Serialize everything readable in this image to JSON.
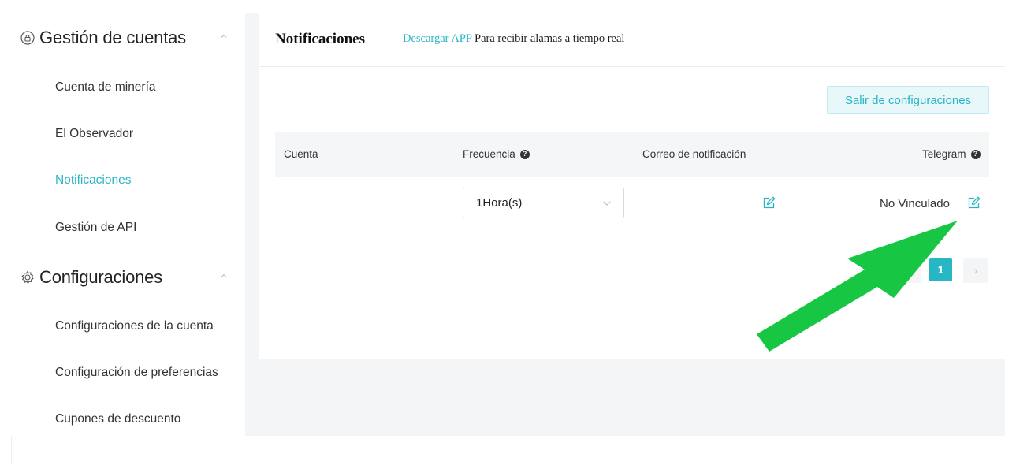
{
  "sidebar": {
    "groups": [
      {
        "title": "Gestión de cuentas",
        "icon": "lock-icon",
        "items": [
          {
            "label": "Cuenta de minería"
          },
          {
            "label": "El Observador"
          },
          {
            "label": "Notificaciones",
            "active": true
          },
          {
            "label": "Gestión de API"
          }
        ]
      },
      {
        "title": "Configuraciones",
        "icon": "gear-icon",
        "items": [
          {
            "label": "Configuraciones de la cuenta"
          },
          {
            "label": "Configuración de preferencias"
          },
          {
            "label": "Cupones de descuento"
          }
        ]
      }
    ]
  },
  "main": {
    "title": "Notificaciones",
    "download_link": "Descargar APP",
    "download_text": "Para recibir alamas a tiempo real",
    "exit_button": "Salir de configuraciones",
    "table": {
      "headers": [
        "Cuenta",
        "Frecuencia",
        "Correo de notificación",
        "Telegram"
      ],
      "rows": [
        {
          "account": "",
          "frequency": "1Hora(s)",
          "telegram_status": "No Vinculado"
        }
      ]
    },
    "pagination": {
      "current_page": "1",
      "prev": "‹",
      "next": "›"
    }
  },
  "colors": {
    "accent": "#26b6c4",
    "annotation_arrow": "#17c744",
    "content_background": "#f4f5f7"
  }
}
